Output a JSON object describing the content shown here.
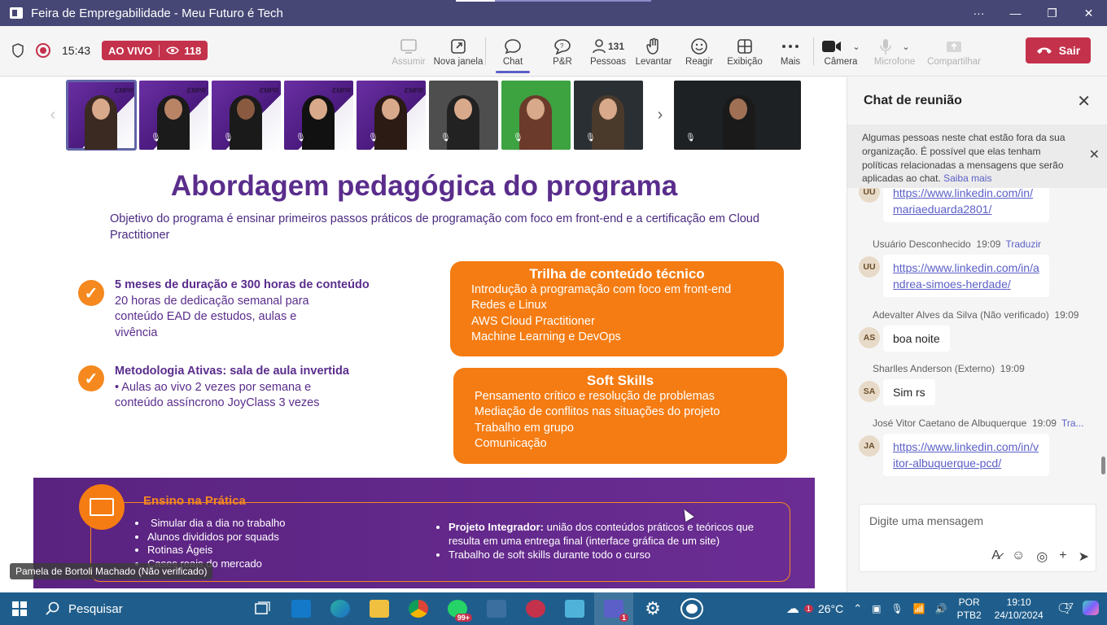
{
  "window": {
    "title": "Feira de Empregabilidade - Meu Futuro é Tech",
    "more": "···",
    "minimize": "—",
    "maximize": "❐",
    "close": "✕"
  },
  "meeting": {
    "time": "15:43",
    "live_label": "AO VIVO",
    "viewer_count": "118",
    "tools": [
      {
        "label": "Assumir",
        "icon": "share-tray-icon",
        "disabled": true
      },
      {
        "label": "Nova janela",
        "icon": "pop-out-icon"
      },
      {
        "label": "Chat",
        "icon": "chat-icon",
        "active": true
      },
      {
        "label": "P&R",
        "icon": "qa-icon"
      },
      {
        "label": "Pessoas",
        "icon": "people-icon",
        "count": "131"
      },
      {
        "label": "Levantar",
        "icon": "raise-hand-icon"
      },
      {
        "label": "Reagir",
        "icon": "react-icon"
      },
      {
        "label": "Exibição",
        "icon": "view-icon"
      },
      {
        "label": "Mais",
        "icon": "more-icon"
      },
      {
        "label": "Câmera",
        "icon": "camera-icon"
      },
      {
        "label": "Microfone",
        "icon": "mic-icon",
        "disabled": true
      },
      {
        "label": "Compartilhar",
        "icon": "share-icon",
        "disabled": true
      }
    ],
    "leave_label": "Sair"
  },
  "gallery": {
    "thumbs": [
      {
        "style": "purple",
        "tag": "EMPR",
        "selected": true
      },
      {
        "style": "purple",
        "tag": "EMPR"
      },
      {
        "style": "purple",
        "tag": "EMPR"
      },
      {
        "style": "purple",
        "tag": "EMPR"
      },
      {
        "style": "purple",
        "tag": "EMPR"
      },
      {
        "style": "gray",
        "tag": ""
      },
      {
        "style": "green",
        "tag": ""
      },
      {
        "style": "dark",
        "tag": ""
      }
    ]
  },
  "slide": {
    "title": "Abordagem pedagógica do programa",
    "subtitle": "Objetivo do programa é ensinar primeiros passos práticos de programação com foco em front-end e a certificação em Cloud Practitioner",
    "block1_head": "5 meses de duração e 300 horas de conteúdo",
    "block1_body": "20 horas de dedicação semanal para conteúdo EAD de estudos, aulas e vivência",
    "block2_head": "Metodologia Ativas: sala de aula invertida",
    "block2_body": "• Aulas ao vivo 2 vezes por semana e conteúdo assíncrono JoyClass 3 vezes",
    "box1_title": "Trilha de conteúdo técnico",
    "box1_items": [
      "Introdução à programação com foco em front-end",
      "Redes e Linux",
      "AWS Cloud Practitioner",
      "Machine Learning e DevOps"
    ],
    "box2_title": "Soft Skills",
    "box2_items": [
      "Pensamento crítico e resolução de problemas",
      "Mediação de conflitos nas situações do projeto",
      "Trabalho em grupo",
      "Comunicação"
    ],
    "practice_title": "Ensino na Prática",
    "practice_items": [
      "Simular dia a dia no trabalho",
      "Alunos divididos por squads",
      "Rotinas Ágeis",
      "Cases reais do mercado"
    ],
    "practice_right_head": "Projeto Integrador:",
    "practice_right_1": "união dos conteúdos práticos e teóricos que resulta em uma entrega final (interface gráfica de um site)",
    "practice_right_2": "Trabalho de soft skills durante todo o curso"
  },
  "speaker_label": "Pamela de Bortoli Machado (Não verificado)",
  "chat": {
    "title": "Chat de reunião",
    "notice": "Algumas pessoas neste chat estão fora da sua organização. É possível que elas tenham políticas relacionadas a mensagens que serão aplicadas ao chat.",
    "notice_link": "Saiba mais",
    "messages": [
      {
        "sender": "",
        "time": "",
        "initials": "UU",
        "text": "https://www.linkedin.com/in/mariaeduarda2801/",
        "link": true
      },
      {
        "sender": "Usuário Desconhecido",
        "time": "19:09",
        "translate": "Traduzir",
        "initials": "UU",
        "text": "https://www.linkedin.com/in/andrea-simoes-herdade/",
        "link": true
      },
      {
        "sender": "Adevalter Alves da Silva (Não verificado)",
        "time": "19:09",
        "initials": "AS",
        "text": "boa noite"
      },
      {
        "sender": "Sharlles Anderson (Externo)",
        "time": "19:09",
        "initials": "SA",
        "text": "Sim rs"
      },
      {
        "sender": "José Vitor Caetano de Albuquerque",
        "time": "19:09",
        "translate": "Tra...",
        "initials": "JA",
        "text": "https://www.linkedin.com/in/vitor-albuquerque-pcd/",
        "link": true
      }
    ],
    "compose_placeholder": "Digite uma mensagem"
  },
  "taskbar": {
    "search_label": "Pesquisar",
    "whatsapp_badge": "99+",
    "teams_badge": "1",
    "weather_temp": "26°C",
    "weather_badge": "1",
    "lang": "POR",
    "layout": "PTB2",
    "clock_time": "19:10",
    "clock_date": "24/10/2024",
    "notifications": "17"
  },
  "colors": {
    "teams_purple": "#464775",
    "accent": "#5b5fc7",
    "live_red": "#c4314b",
    "slide_purple": "#5a2d8c",
    "slide_orange": "#f57c12",
    "taskbar": "#1f5e8c"
  }
}
